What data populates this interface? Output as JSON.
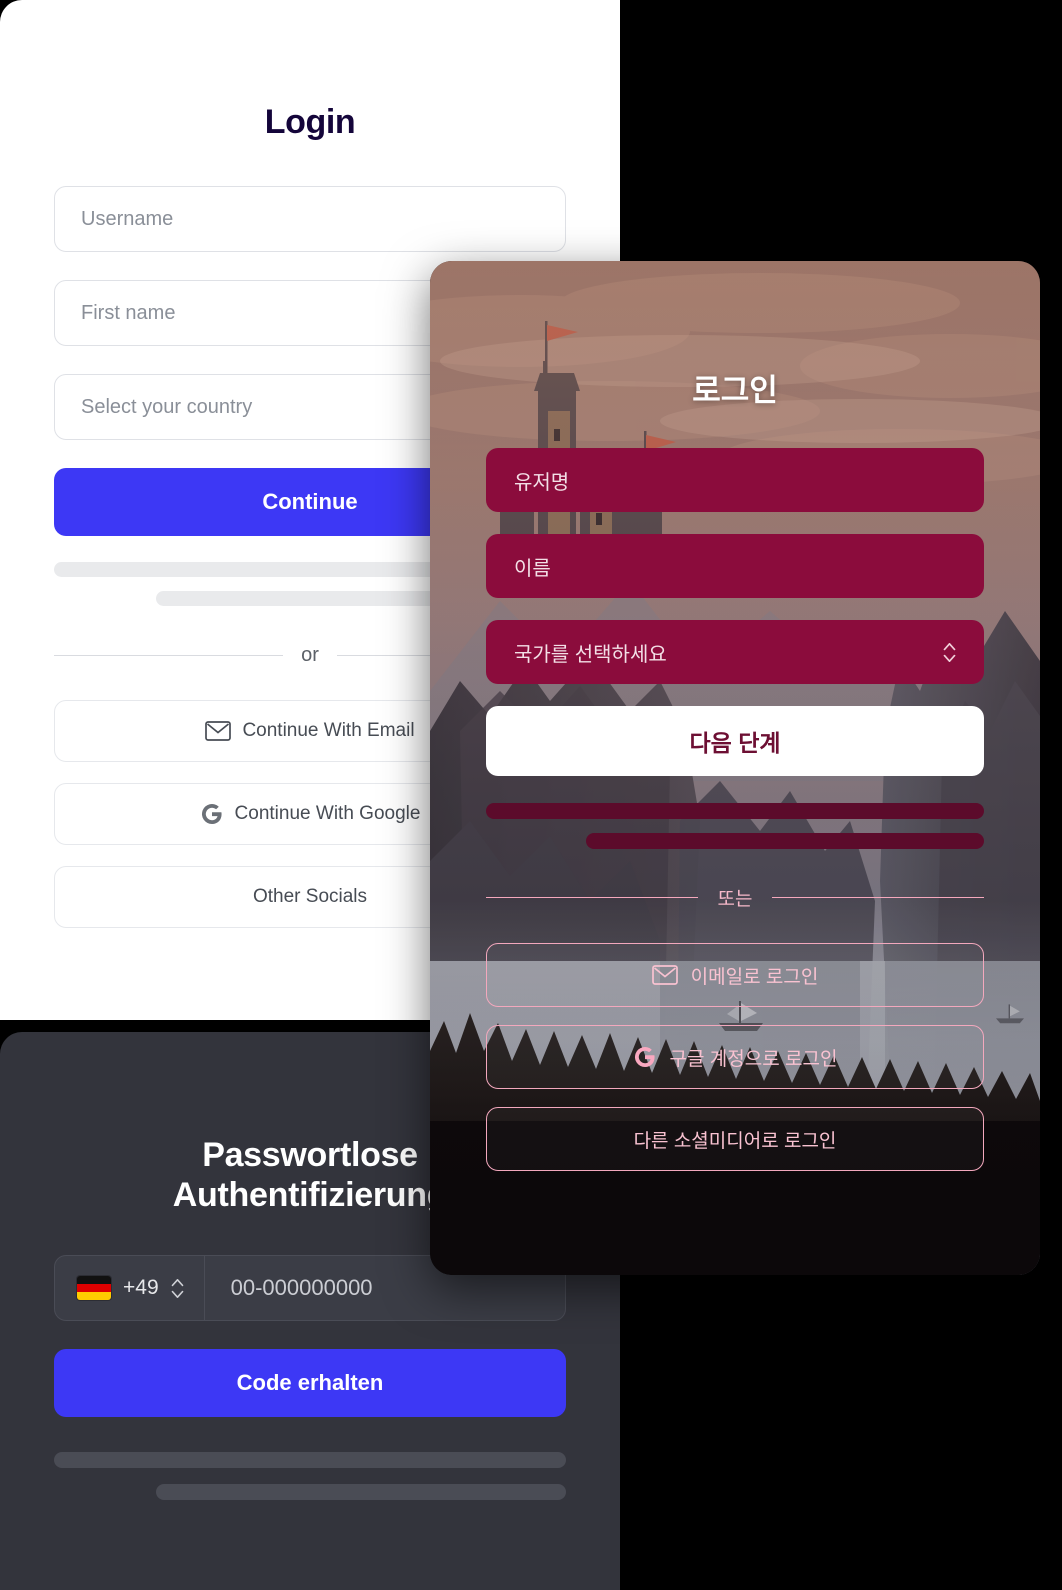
{
  "colors": {
    "accent_blue": "#3d38f5",
    "dark_panel": "#33343c",
    "korean_field": "#8b0c3c",
    "korean_outline": "#f3a8bd",
    "light_panel": "#ffffff",
    "backdrop": "#000000"
  },
  "panel_en": {
    "title": "Login",
    "fields": [
      {
        "placeholder": "Username",
        "type": "text"
      },
      {
        "placeholder": "First name",
        "type": "text"
      },
      {
        "placeholder": "Select your country",
        "type": "select"
      }
    ],
    "cta_label": "Continue",
    "divider_label": "or",
    "socials": [
      {
        "label": "Continue With Email",
        "icon": "mail-icon"
      },
      {
        "label": "Continue With Google",
        "icon": "google-icon"
      },
      {
        "label": "Other Socials",
        "icon": ""
      }
    ]
  },
  "panel_de": {
    "title_line1": "Passwortlose",
    "title_line2": "Authentifizierung",
    "country_code": "+49",
    "flag": "german-flag-icon",
    "phone_placeholder": "00-000000000",
    "cta_label": "Code erhalten"
  },
  "panel_ko": {
    "title": "로그인",
    "fields": [
      {
        "placeholder": "유저명",
        "type": "text"
      },
      {
        "placeholder": "이름",
        "type": "text"
      },
      {
        "placeholder": "국가를 선택하세요",
        "type": "select"
      }
    ],
    "cta_label": "다음 단계",
    "divider_label": "또는",
    "socials": [
      {
        "label": "이메일로 로그인",
        "icon": "mail-icon"
      },
      {
        "label": "구글 계정으로 로그인",
        "icon": "google-icon"
      },
      {
        "label": "다른 소셜미디어로 로그인",
        "icon": ""
      }
    ]
  }
}
